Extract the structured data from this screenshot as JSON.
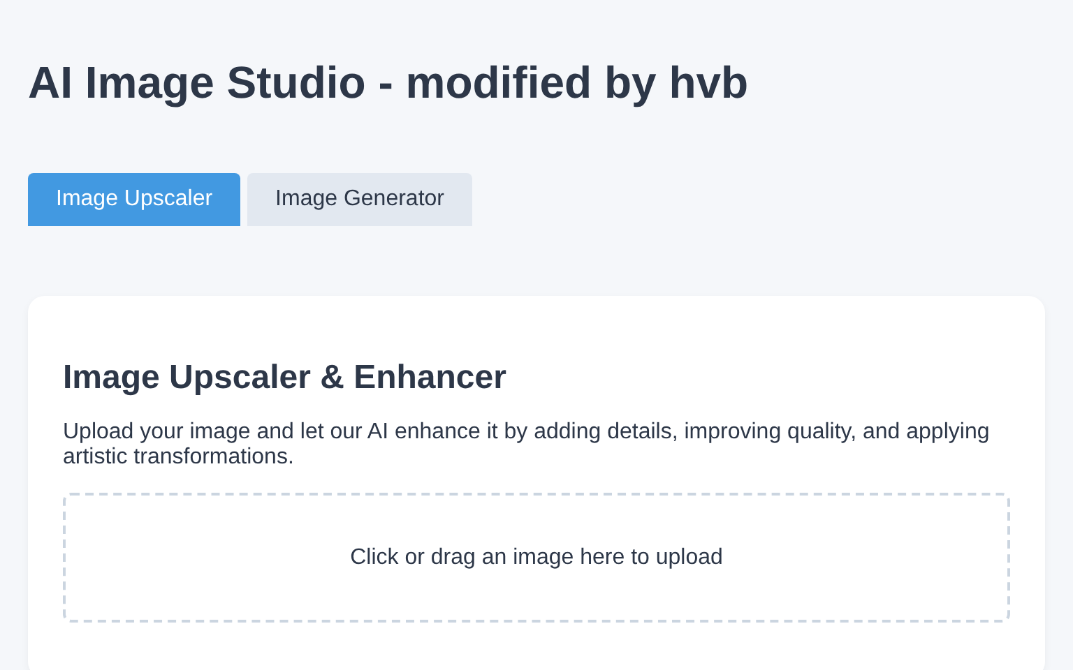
{
  "page": {
    "title": "AI Image Studio - modified by hvb"
  },
  "tabs": [
    {
      "label": "Image Upscaler",
      "selected": true
    },
    {
      "label": "Image Generator",
      "selected": false
    }
  ],
  "panel": {
    "heading": "Image Upscaler & Enhancer",
    "description": "Upload your image and let our AI enhance it by adding details, improving quality, and applying artistic transformations.",
    "dropzone": {
      "label": "Click or drag an image here to upload"
    }
  }
}
